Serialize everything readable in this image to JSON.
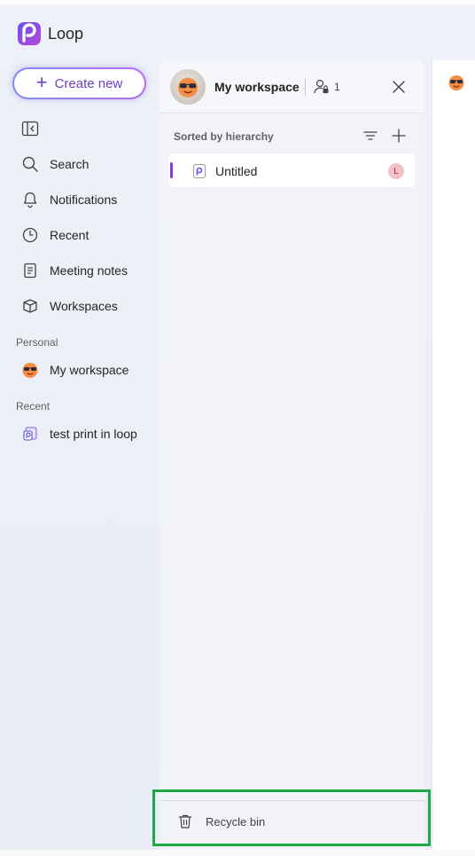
{
  "app": {
    "name": "Loop"
  },
  "nav": {
    "create_label": "Create new",
    "items": [
      {
        "label": "Search",
        "icon": "search-icon"
      },
      {
        "label": "Notifications",
        "icon": "bell-icon"
      },
      {
        "label": "Recent",
        "icon": "clock-icon"
      },
      {
        "label": "Meeting notes",
        "icon": "notes-icon"
      },
      {
        "label": "Workspaces",
        "icon": "workspaces-icon"
      }
    ],
    "personal_label": "Personal",
    "personal_item": "My workspace",
    "recent_label": "Recent",
    "recent_item": "test print in loop"
  },
  "workspace": {
    "title": "My workspace",
    "member_count": "1",
    "sort_label": "Sorted by hierarchy",
    "pages": [
      {
        "title": "Untitled",
        "author_initial": "L"
      }
    ],
    "recycle_label": "Recycle bin"
  },
  "colors": {
    "accent": "#7b3fd6",
    "create_text": "#6b3fc9",
    "highlight": "#22a64a"
  }
}
